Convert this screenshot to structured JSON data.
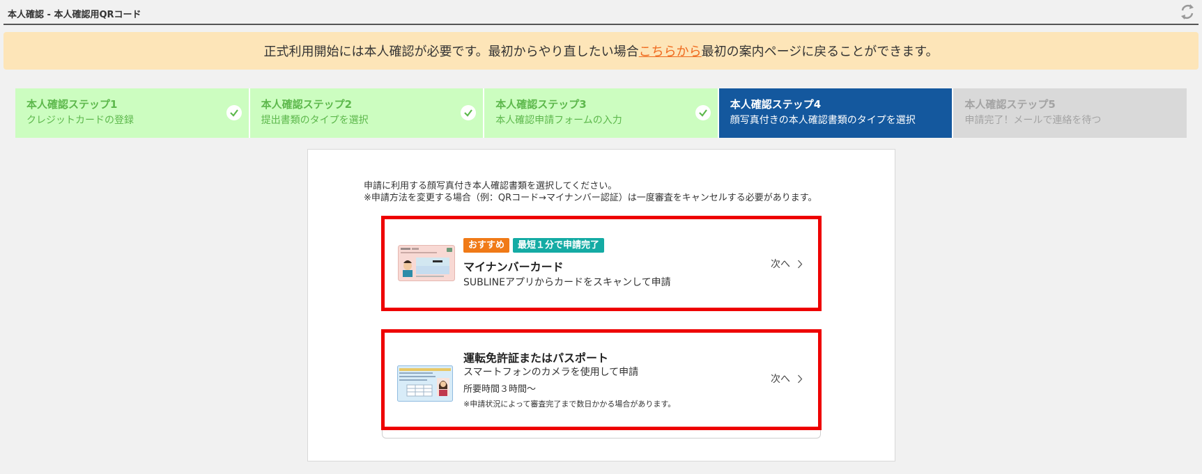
{
  "header": {
    "title": "本人確認 - 本人確認用QRコード",
    "refresh_icon": "refresh-arrows-icon"
  },
  "notice": {
    "text_before": "正式利用開始には本人確認が必要です。最初からやり直したい場合",
    "link_text": "こちらから",
    "text_after": "最初の案内ページに戻ることができます。"
  },
  "steps": [
    {
      "title": "本人確認ステップ1",
      "subtitle": "クレジットカードの登録",
      "status": "done"
    },
    {
      "title": "本人確認ステップ2",
      "subtitle": "提出書類のタイプを選択",
      "status": "done"
    },
    {
      "title": "本人確認ステップ3",
      "subtitle": "本人確認申請フォームの入力",
      "status": "done"
    },
    {
      "title": "本人確認ステップ4",
      "subtitle": "顔写真付きの本人確認書類のタイプを選択",
      "status": "active"
    },
    {
      "title": "本人確認ステップ5",
      "subtitle": "申請完了！メールで連絡を待つ",
      "status": "pending"
    }
  ],
  "intro": {
    "line1": "申請に利用する顔写真付き本人確認書類を選択してください。",
    "line2": "※申請方法を変更する場合（例：QRコード→マイナンバー認証）は一度審査をキャンセルする必要があります。"
  },
  "options": [
    {
      "badges": [
        "おすすめ",
        "最短１分で申請完了"
      ],
      "title": "マイナンバーカード",
      "description": "SUBLINEアプリからカードをスキャンして申請",
      "next_label": "次へ",
      "icon": "my-number-card-icon"
    },
    {
      "title": "運転免許証またはパスポート",
      "description": "スマートフォンのカメラを使用して申請",
      "time": "所要時間３時間～",
      "note": "※申請状況によって審査完了まで数日かかる場合があります。",
      "next_label": "次へ",
      "icon": "driver-license-icon"
    }
  ],
  "colors": {
    "step_done_bg": "#ccfdc0",
    "step_done_text": "#5db84c",
    "step_active_bg": "#14589e",
    "step_pending_bg": "#d9d9d9",
    "notice_bg": "#fde5b8",
    "link": "#ef6a1e",
    "highlight_border": "#ee0000"
  }
}
